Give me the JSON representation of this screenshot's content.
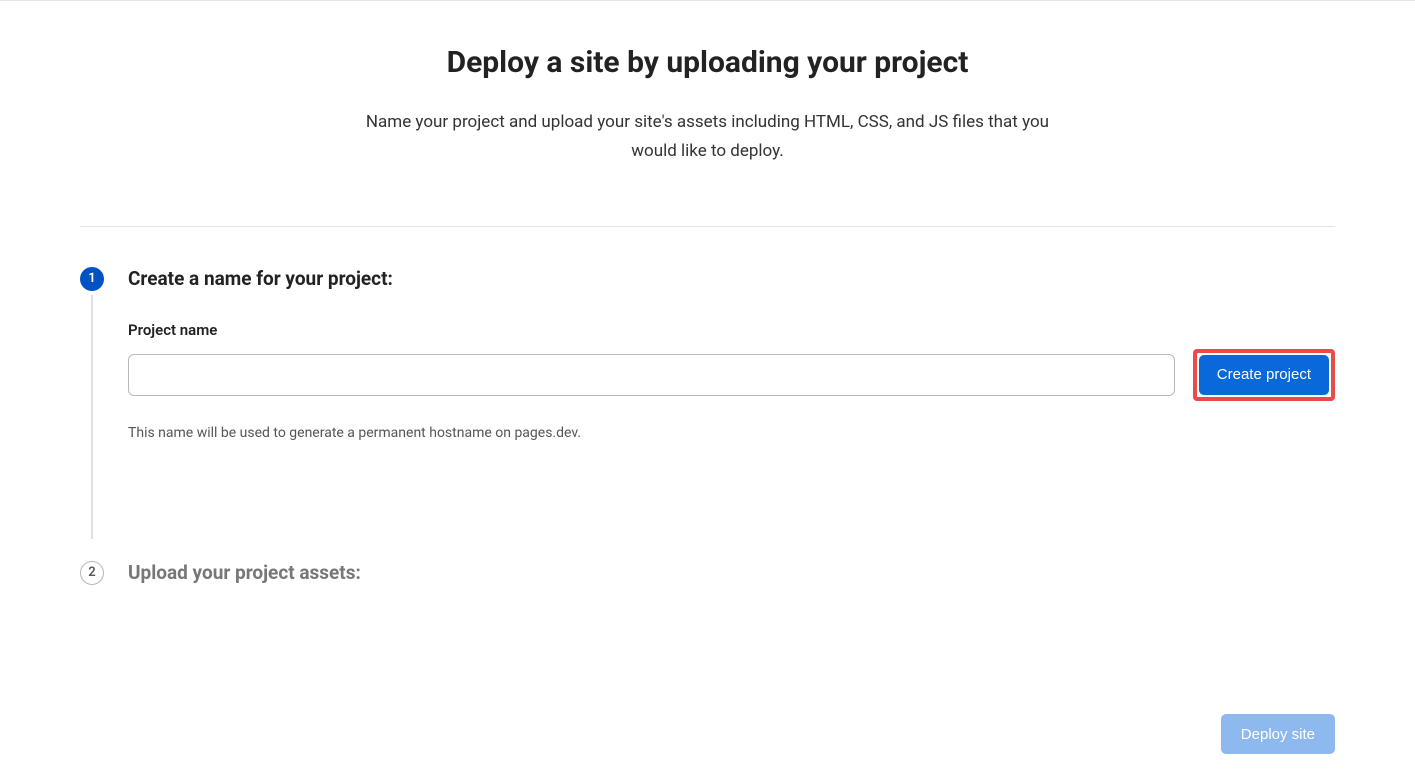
{
  "header": {
    "title": "Deploy a site by uploading your project",
    "subtitle": "Name your project and upload your site's assets including HTML, CSS, and JS files that you would like to deploy."
  },
  "steps": {
    "step1": {
      "number": "1",
      "title": "Create a name for your project:",
      "field_label": "Project name",
      "input_value": "",
      "help_text": "This name will be used to generate a permanent hostname on pages.dev.",
      "button_label": "Create project"
    },
    "step2": {
      "number": "2",
      "title": "Upload your project assets:"
    }
  },
  "footer": {
    "deploy_label": "Deploy site"
  }
}
